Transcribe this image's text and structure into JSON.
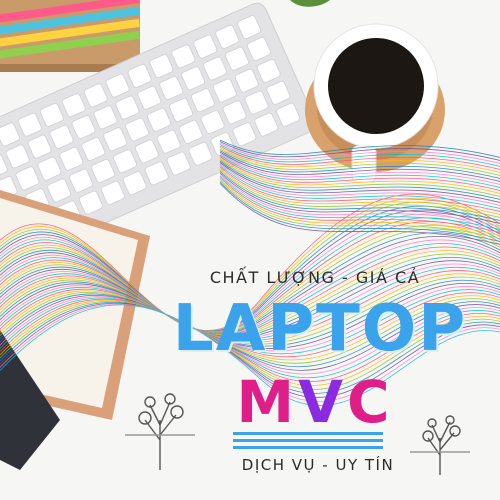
{
  "poster": {
    "tagline_top": "CHẤT LƯỢNG - GIÁ CẢ",
    "brand_title": "LAPTOP",
    "brand_sub": {
      "m": "M",
      "v": "V",
      "c": "C"
    },
    "tagline_bottom": "DỊCH VỤ - UY TÍN"
  },
  "colors": {
    "title_blue": "#3aa3ec",
    "sub_pink": "#e01e8a",
    "sub_purple": "#8a2be2",
    "text_dark": "#2b2b2b"
  },
  "icons": [
    "keyboard-illustration",
    "coffee-cup-illustration",
    "notebook-illustration",
    "pencils-illustration",
    "tree-icon"
  ]
}
